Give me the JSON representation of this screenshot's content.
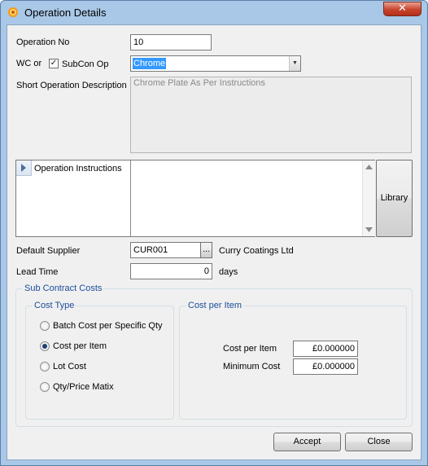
{
  "window": {
    "title": "Operation Details",
    "close_glyph": "✕",
    "icon": "cog-icon"
  },
  "form": {
    "operation_no_label": "Operation No",
    "operation_no_value": "10",
    "wc_or_label": "WC or",
    "subcon_op_label": "SubCon Op",
    "subcon_op_checked": true,
    "subcon_op_check_glyph": "✓",
    "operation_value": "Chrome",
    "short_desc_label": "Short Operation Description",
    "short_desc_value": "Chrome Plate As Per Instructions",
    "operation_instructions_label": "Operation Instructions",
    "library_button": "Library",
    "default_supplier_label": "Default Supplier",
    "default_supplier_value": "CUR001",
    "supplier_browse_label": "...",
    "supplier_name": "Curry Coatings Ltd",
    "lead_time_label": "Lead Time",
    "lead_time_value": "0",
    "lead_time_unit": "days"
  },
  "subcontract": {
    "group_title": "Sub Contract Costs",
    "cost_type": {
      "title": "Cost Type",
      "options": [
        {
          "label": "Batch Cost per Specific Qty",
          "selected": false
        },
        {
          "label": "Cost per Item",
          "selected": true
        },
        {
          "label": "Lot Cost",
          "selected": false
        },
        {
          "label": "Qty/Price Matix",
          "selected": false
        }
      ]
    },
    "cost_per_item": {
      "title": "Cost per Item",
      "cost_per_item_label": "Cost per Item",
      "cost_per_item_value": "£0.000000",
      "minimum_cost_label": "Minimum Cost",
      "minimum_cost_value": "£0.000000"
    }
  },
  "buttons": {
    "accept": "Accept",
    "close": "Close"
  },
  "colors": {
    "window_frame": "#a9c7e6",
    "close_button": "#c7432c",
    "selection": "#3399ff",
    "group_title": "#1b4d9c"
  }
}
